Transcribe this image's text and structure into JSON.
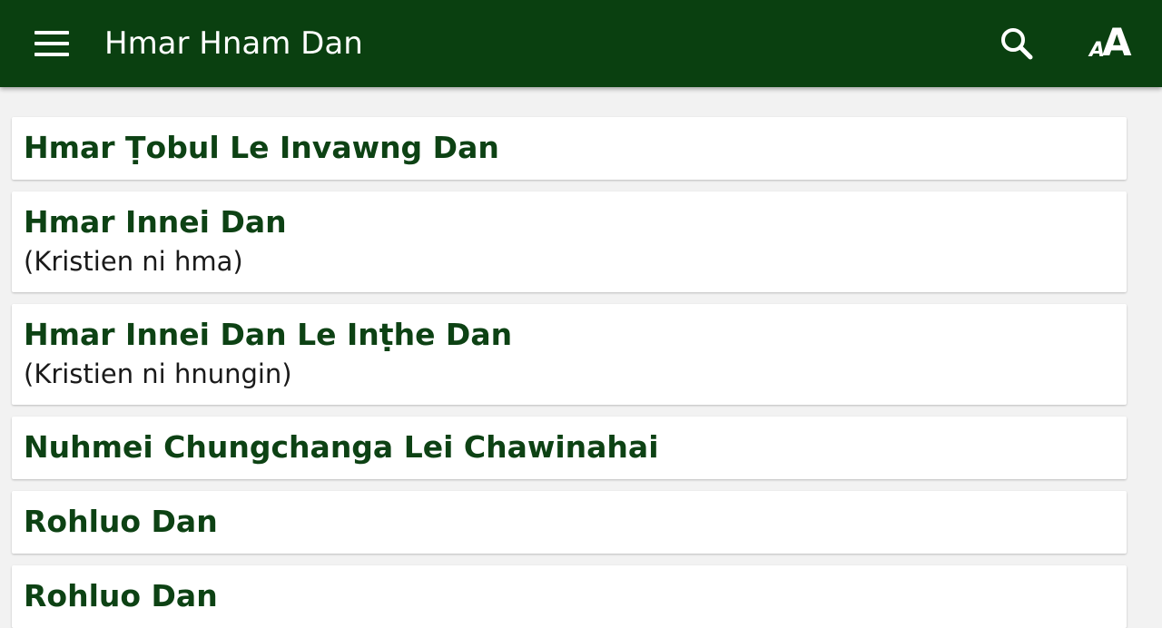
{
  "app_bar": {
    "title": "Hmar Hnam Dan",
    "menu_icon": "hamburger-menu-icon",
    "search_icon": "search-icon",
    "font_size_icon": "font-size-icon",
    "font_size_small_glyph": "A",
    "font_size_large_glyph": "A",
    "background_color": "#0a4010"
  },
  "items": [
    {
      "title": "Hmar Ṭobul Le Invawng Dan",
      "subtitle": ""
    },
    {
      "title": "Hmar Innei Dan",
      "subtitle": "(Kristien ni hma)"
    },
    {
      "title": "Hmar Innei Dan Le Inṭhe Dan",
      "subtitle": "(Kristien ni hnungin)"
    },
    {
      "title": "Nuhmei Chungchanga Lei Chawinahai",
      "subtitle": ""
    },
    {
      "title": "Rohluo Dan",
      "subtitle": ""
    },
    {
      "title": "Rohluo Dan",
      "subtitle": ""
    }
  ],
  "colors": {
    "title_text": "#0d4214",
    "page_background": "#f2f2f2",
    "card_background": "#ffffff"
  }
}
